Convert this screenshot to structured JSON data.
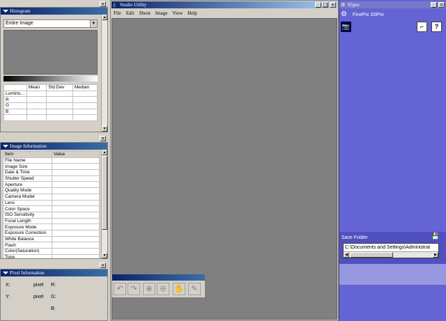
{
  "histogram": {
    "title": "Histogram",
    "dropdown": "Entire Image",
    "headers": [
      "",
      "Mean",
      "Std Dev",
      "Median"
    ],
    "rows": [
      "Lumino…",
      "R",
      "G",
      "B"
    ]
  },
  "image_info": {
    "title": "Image Information",
    "headers": [
      "Item",
      "Value"
    ],
    "rows": [
      "File Name",
      "Image Size",
      "Date & Time",
      "Shutter Speed",
      "Aperture",
      "Quality Mode",
      "Camera Model",
      "Lens",
      "Color Space",
      "ISO Sensitivity",
      "Focal Length",
      "Exposure Mode",
      "Exposure Correction",
      "White Balance",
      "Flash",
      "Color(Saturation)",
      "Tone"
    ]
  },
  "pixel_info": {
    "title": "Pixel Information",
    "x_label": "X:",
    "y_label": "Y:",
    "x_unit": "pixel",
    "y_unit": "pixel",
    "r_label": "R:",
    "g_label": "G:",
    "b_label": "B:"
  },
  "studio": {
    "title": "Studio Utility",
    "menus": [
      "File",
      "Edit",
      "Shoot",
      "Image",
      "View",
      "Help"
    ]
  },
  "right_panel": {
    "title": "S5pro",
    "camera_name": "FinePix S5Pro",
    "save_folder_label": "Save Folder",
    "save_folder_path": "C:\\Documents and Settings\\Administrat"
  },
  "colors": {
    "titlebar": "#0a246a",
    "panel_bg": "#d4d0c8",
    "canvas": "#808080",
    "right_panel": "#6464d4"
  }
}
